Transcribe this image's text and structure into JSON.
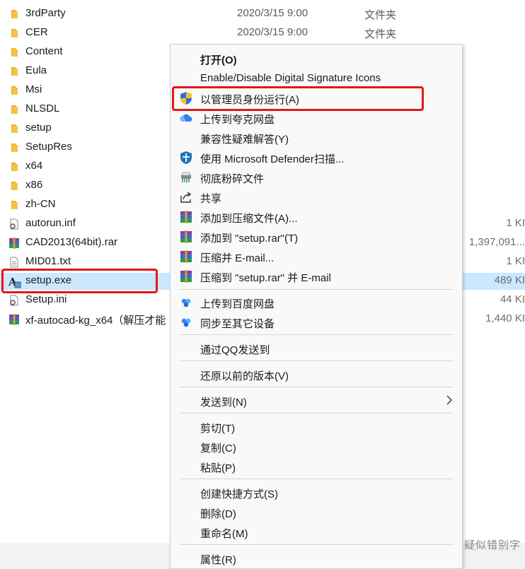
{
  "files": [
    {
      "name": "3rdParty",
      "date": "2020/3/15 9:00",
      "type": "文件夹",
      "size": "",
      "icon": "folder-icon"
    },
    {
      "name": "CER",
      "date": "2020/3/15 9:00",
      "type": "文件夹",
      "size": "",
      "icon": "folder-icon"
    },
    {
      "name": "Content",
      "date": "",
      "type": "",
      "size": "",
      "icon": "folder-icon"
    },
    {
      "name": "Eula",
      "date": "",
      "type": "",
      "size": "",
      "icon": "folder-icon"
    },
    {
      "name": "Msi",
      "date": "",
      "type": "",
      "size": "",
      "icon": "folder-icon"
    },
    {
      "name": "NLSDL",
      "date": "",
      "type": "",
      "size": "",
      "icon": "folder-icon"
    },
    {
      "name": "setup",
      "date": "",
      "type": "",
      "size": "",
      "icon": "folder-icon"
    },
    {
      "name": "SetupRes",
      "date": "",
      "type": "",
      "size": "",
      "icon": "folder-icon"
    },
    {
      "name": "x64",
      "date": "",
      "type": "",
      "size": "",
      "icon": "folder-icon"
    },
    {
      "name": "x86",
      "date": "",
      "type": "",
      "size": "",
      "icon": "folder-icon"
    },
    {
      "name": "zh-CN",
      "date": "",
      "type": "",
      "size": "",
      "icon": "folder-icon"
    },
    {
      "name": "autorun.inf",
      "date": "",
      "type": "",
      "size": "1 KI",
      "icon": "settings-file-icon"
    },
    {
      "name": "CAD2013(64bit).rar",
      "date": "",
      "type": "",
      "size": "1,397,091...",
      "icon": "winrar-archive-icon"
    },
    {
      "name": "MID01.txt",
      "date": "",
      "type": "",
      "size": "1 KI",
      "icon": "text-file-icon"
    },
    {
      "name": "setup.exe",
      "date": "",
      "type": "",
      "size": "489 KI",
      "icon": "autocad-setup-icon",
      "selected": true
    },
    {
      "name": "Setup.ini",
      "date": "",
      "type": "",
      "size": "44 KI",
      "icon": "settings-file-icon"
    },
    {
      "name": "xf-autocad-kg_x64（解压才能",
      "date": "",
      "type": "",
      "size": "1,440 KI",
      "icon": "winrar-archive-icon"
    }
  ],
  "context_menu": {
    "items": [
      {
        "label": "打开(O)",
        "icon": "",
        "bold": true
      },
      {
        "label": "Enable/Disable Digital Signature Icons",
        "icon": ""
      },
      {
        "label": "以管理员身份运行(A)",
        "icon": "uac-shield-icon"
      },
      {
        "label": "上传到夸克网盘",
        "icon": "quark-cloud-icon"
      },
      {
        "label": "兼容性疑难解答(Y)",
        "icon": ""
      },
      {
        "label": "使用 Microsoft Defender扫描...",
        "icon": "defender-shield-icon"
      },
      {
        "label": "彻底粉碎文件",
        "icon": "shredder-icon"
      },
      {
        "label": "共享",
        "icon": "share-icon"
      },
      {
        "label": "添加到压缩文件(A)...",
        "icon": "winrar-icon"
      },
      {
        "label": "添加到 \"setup.rar\"(T)",
        "icon": "winrar-icon"
      },
      {
        "label": "压缩并 E-mail...",
        "icon": "winrar-icon"
      },
      {
        "label": "压缩到 \"setup.rar\" 并 E-mail",
        "icon": "winrar-icon"
      },
      {
        "label": "上传到百度网盘",
        "icon": "baidu-cloud-icon"
      },
      {
        "label": "同步至其它设备",
        "icon": "baidu-cloud-icon"
      },
      {
        "label": "通过QQ发送到",
        "icon": ""
      },
      {
        "label": "还原以前的版本(V)",
        "icon": ""
      },
      {
        "label": "发送到(N)",
        "icon": "",
        "submenu": true
      },
      {
        "label": "剪切(T)",
        "icon": ""
      },
      {
        "label": "复制(C)",
        "icon": ""
      },
      {
        "label": "粘贴(P)",
        "icon": ""
      },
      {
        "label": "创建快捷方式(S)",
        "icon": ""
      },
      {
        "label": "删除(D)",
        "icon": ""
      },
      {
        "label": "重命名(M)",
        "icon": ""
      },
      {
        "label": "属性(R)",
        "icon": ""
      }
    ]
  },
  "watermark": "疑似错别字",
  "colors": {
    "highlight_border": "#e5161b",
    "selection": "#cce8ff",
    "folder": "#f4c344"
  }
}
